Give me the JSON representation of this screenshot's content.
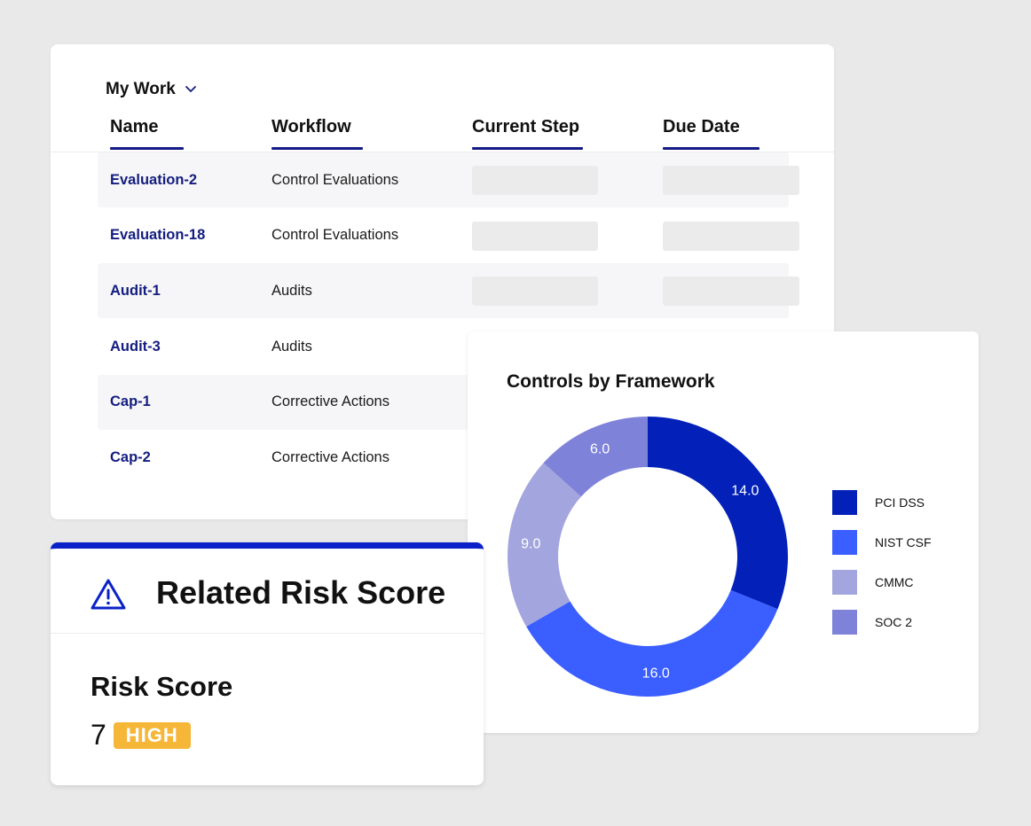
{
  "work": {
    "title": "My Work",
    "columns": [
      "Name",
      "Workflow",
      "Current Step",
      "Due Date"
    ],
    "rows": [
      {
        "name": "Evaluation-2",
        "workflow": "Control Evaluations",
        "striped": true,
        "skeleton": true
      },
      {
        "name": "Evaluation-18",
        "workflow": "Control Evaluations",
        "striped": false,
        "skeleton": true
      },
      {
        "name": "Audit-1",
        "workflow": "Audits",
        "striped": true,
        "skeleton": true
      },
      {
        "name": "Audit-3",
        "workflow": "Audits",
        "striped": false,
        "skeleton": false
      },
      {
        "name": "Cap-1",
        "workflow": "Corrective Actions",
        "striped": true,
        "skeleton": false
      },
      {
        "name": "Cap-2",
        "workflow": "Corrective Actions",
        "striped": false,
        "skeleton": false
      }
    ]
  },
  "chart_data": {
    "type": "pie",
    "variant": "donut",
    "title": "Controls by Framework",
    "categories": [
      "PCI DSS",
      "NIST CSF",
      "CMMC",
      "SOC 2"
    ],
    "values": [
      14.0,
      16.0,
      9.0,
      6.0
    ],
    "labels": [
      "14.0",
      "16.0",
      "9.0",
      "6.0"
    ],
    "colors": [
      "#0321b8",
      "#3a5eff",
      "#a3a5de",
      "#7e82d9"
    ],
    "start_angle": "12 o'clock",
    "direction": "clockwise",
    "legend": "right"
  },
  "risk": {
    "title": "Related Risk Score",
    "icon": "warning-triangle-icon",
    "score_label": "Risk Score",
    "score_value": "7",
    "level": "HIGH",
    "level_color": "#f6b638",
    "accent_color": "#0a22c8"
  }
}
